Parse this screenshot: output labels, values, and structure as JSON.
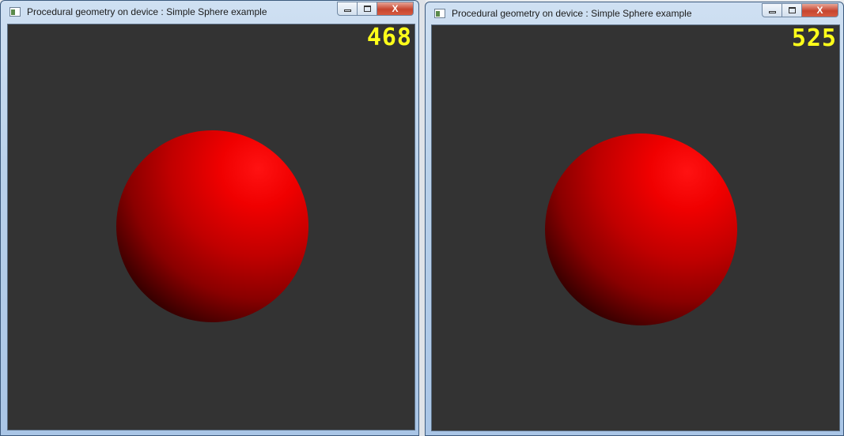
{
  "windows": [
    {
      "title": "Procedural geometry on device : Simple Sphere example",
      "fps": "468",
      "close_label": "X"
    },
    {
      "title": "Procedural geometry on device : Simple Sphere example",
      "fps": "525",
      "close_label": "X"
    }
  ],
  "colors": {
    "viewport_background": "#333333",
    "fps_counter": "#ffff1a",
    "sphere": "#ff0000"
  },
  "icons": [
    "app-icon",
    "minimize-icon",
    "maximize-icon",
    "close-icon"
  ]
}
